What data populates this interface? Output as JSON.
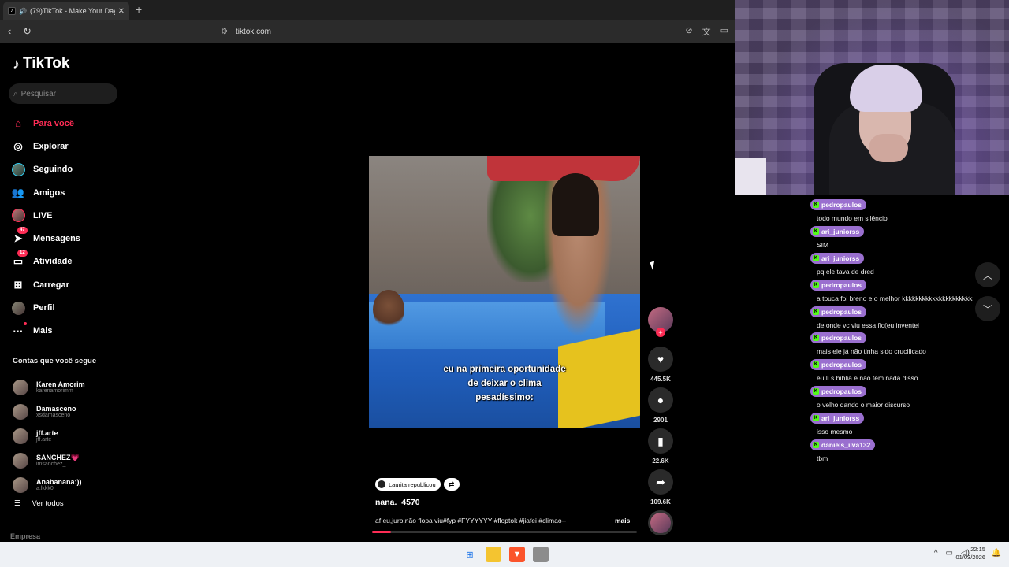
{
  "browser": {
    "tab_title": "(79)TikTok - Make Your Day",
    "tab_close": "✕",
    "new_tab": "+",
    "url": "tiktok.com"
  },
  "sidebar": {
    "logo": "TikTok",
    "search_placeholder": "Pesquisar",
    "menu": [
      {
        "label": "Para você",
        "icon": "home-icon",
        "active": true
      },
      {
        "label": "Explorar",
        "icon": "compass-icon"
      },
      {
        "label": "Seguindo",
        "icon": "following-avatar-icon"
      },
      {
        "label": "Amigos",
        "icon": "friends-icon"
      },
      {
        "label": "LIVE",
        "icon": "live-avatar-icon"
      },
      {
        "label": "Mensagens",
        "icon": "messages-icon",
        "badge": "47"
      },
      {
        "label": "Atividade",
        "icon": "activity-icon",
        "badge": "12"
      },
      {
        "label": "Carregar",
        "icon": "upload-icon"
      },
      {
        "label": "Perfil",
        "icon": "profile-avatar-icon"
      },
      {
        "label": "Mais",
        "icon": "more-icon"
      }
    ],
    "following_title": "Contas que você segue",
    "following": [
      {
        "name": "Karen Amorim",
        "handle": "karenamorimm"
      },
      {
        "name": "Damasceno",
        "handle": "xsdamasceno"
      },
      {
        "name": "jff.arte",
        "handle": "jff.arte"
      },
      {
        "name": "SANCHEZ💗",
        "handle": "imsanchez_"
      },
      {
        "name": "Anabanana:))",
        "handle": "a.lkkk0"
      }
    ],
    "see_all": "Ver todos",
    "footer": "Empresa"
  },
  "video": {
    "caption_line1": "eu na primeira oportunidade",
    "caption_line2": "de deixar o clima",
    "caption_line3": "pesadíssimo:",
    "reposted_by": "Laurita republicou",
    "author": "nana._4570",
    "description": "af eu,juro,não flopa viu#fyp #FYYYYYY #floptok #jiafei #climao--",
    "more": "mais",
    "progress": 0.07
  },
  "actions": {
    "likes": "445.5K",
    "comments": "2901",
    "saves": "22.6K",
    "shares": "109.6K"
  },
  "chat": [
    {
      "user": "pedropaulos",
      "text": "todo mundo em silêncio"
    },
    {
      "user": "ari_juniorss",
      "text": "SIM"
    },
    {
      "user": "ari_juniorss",
      "text": "pq ele tava de dred"
    },
    {
      "user": "pedropaulos",
      "text": "a touca foi breno e o melhor kkkkkkkkkkkkkkkkkkkkk"
    },
    {
      "user": "pedropaulos",
      "text": "de onde vc viu essa fic(eu inventei"
    },
    {
      "user": "pedropaulos",
      "text": "mais ele já não tinha sido crucificado"
    },
    {
      "user": "pedropaulos",
      "text": "eu li s bíblia e não tem nada disso"
    },
    {
      "user": "pedropaulos",
      "text": "o velho dando o maior discurso"
    },
    {
      "user": "ari_juniorss",
      "text": "isso mesmo"
    },
    {
      "user": "daniels_ilva132",
      "text": "tbm"
    },
    {
      "user": "pedropaulos",
      "text": ""
    }
  ],
  "taskbar": {
    "time": "22:15",
    "date": "01/03/2026"
  },
  "colors": {
    "accent": "#fe2c55",
    "chat_badge": "#9a6fcf"
  }
}
